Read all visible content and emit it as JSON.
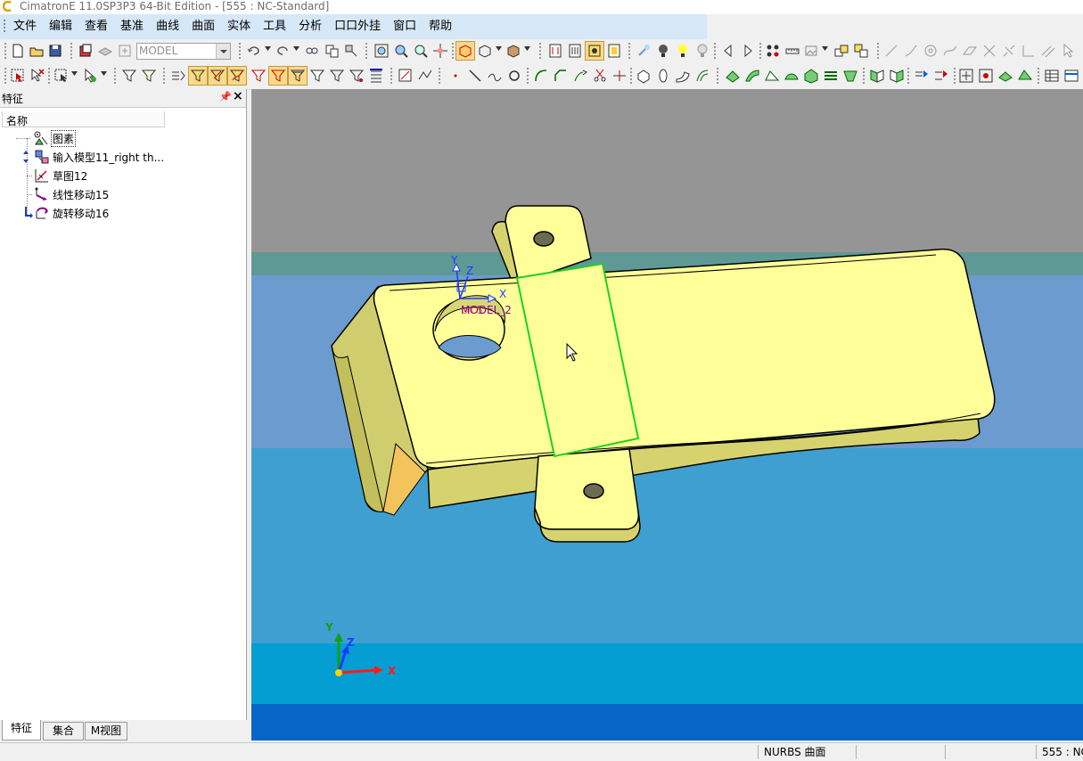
{
  "window": {
    "title": "CimatronE 11.0SP3P3 64-Bit Edition - [555 : NC-Standard]"
  },
  "menu": {
    "items": [
      "文件",
      "编辑",
      "查看",
      "基准",
      "曲线",
      "曲面",
      "实体",
      "工具",
      "分析",
      "口口外挂",
      "窗口",
      "帮助"
    ]
  },
  "toolbar": {
    "model_combo_value": "MODEL"
  },
  "panel": {
    "title": "特征",
    "column_header": "名称",
    "items": [
      {
        "label": "图素",
        "icon": "entities-icon"
      },
      {
        "label": "输入模型11_right th...",
        "icon": "import-model-icon"
      },
      {
        "label": "草图12",
        "icon": "sketch-icon"
      },
      {
        "label": "线性移动15",
        "icon": "linear-move-icon"
      },
      {
        "label": "旋转移动16",
        "icon": "rotate-move-icon"
      }
    ]
  },
  "tabs": [
    "特征",
    "集合",
    "M视图"
  ],
  "viewport": {
    "ucs_labels": {
      "x": "X",
      "y": "Y",
      "z": "Z",
      "name": "MODEL_2",
      "overlap": "UCS"
    },
    "triad_labels": {
      "x": "X",
      "y": "Y",
      "z": "Z"
    },
    "colors": {
      "part_face": "#ffff99",
      "part_edge": "#000000",
      "selected_face_edge": "#1fd11f",
      "axis_x": "#ff1a1a",
      "axis_y": "#12a012",
      "axis_z": "#1a3cff"
    }
  },
  "status": {
    "entity_type": "NURBS 曲面",
    "right": "555 : NC"
  }
}
